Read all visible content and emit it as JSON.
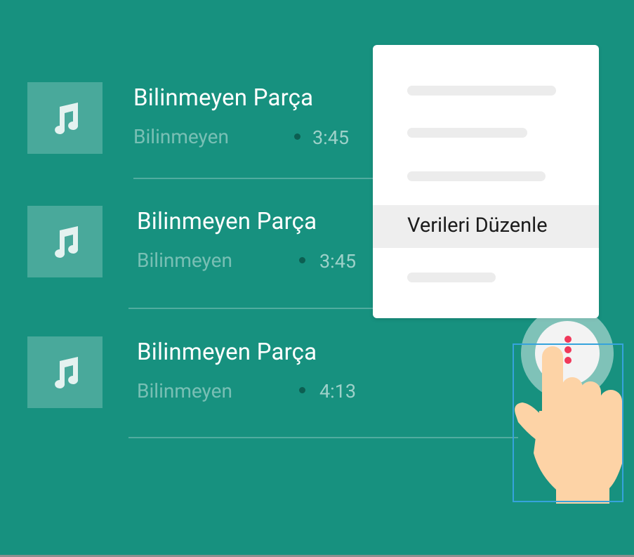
{
  "tracks": [
    {
      "title": "Bilinmeyen Parça",
      "artist": "Bilinmeyen",
      "duration": "3:45",
      "icon": "music-note-icon"
    },
    {
      "title": "Bilinmeyen Parça",
      "artist": "Bilinmeyen",
      "duration": "3:45",
      "icon": "music-note-icon"
    },
    {
      "title": "Bilinmeyen Parça",
      "artist": "Bilinmeyen",
      "duration": "4:13",
      "icon": "music-note-icon"
    }
  ],
  "context_menu": {
    "highlighted_label": "Verileri Düzenle"
  },
  "overflow_button": {
    "icon": "more-vert-icon"
  },
  "colors": {
    "background": "#17917f",
    "menu_background": "#ffffff",
    "highlight": "#eeeeee",
    "accent": "#f0385a",
    "selection_outline": "#36a3dc"
  }
}
